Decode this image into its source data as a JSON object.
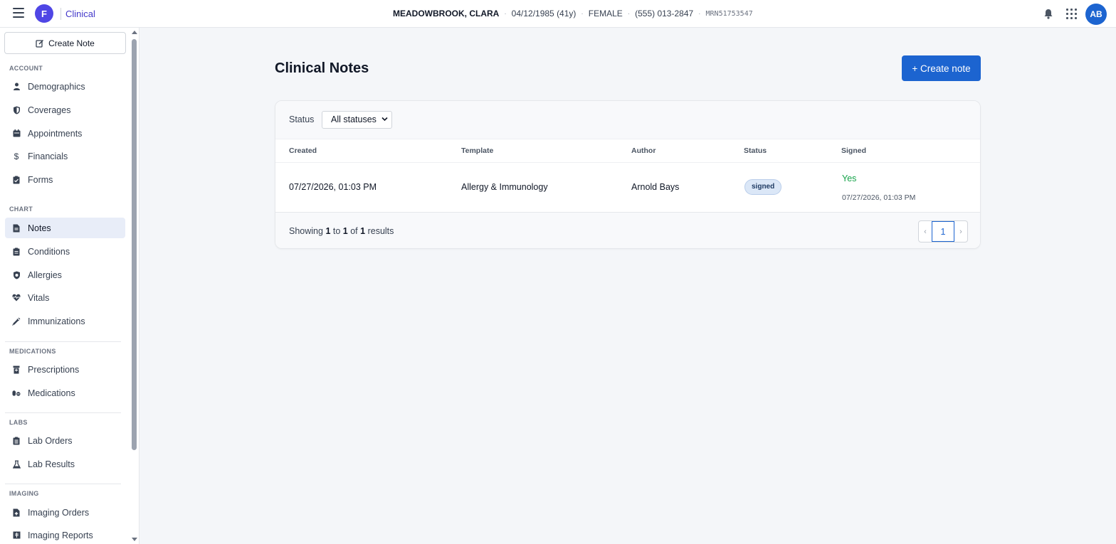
{
  "app": {
    "logo_letter": "F",
    "brand": "Clinical"
  },
  "patient": {
    "name": "MEADOWBROOK, CLARA",
    "dob": "04/12/1985 (41y)",
    "sex": "FEMALE",
    "phone": "(555) 013-2847",
    "mrn": "MRN51753547",
    "separator": "·"
  },
  "user": {
    "initials": "AB"
  },
  "sidebar": {
    "create_note_label": "Create Note",
    "sections": {
      "account": "ACCOUNT",
      "chart": "CHART",
      "medications": "MEDICATIONS",
      "labs": "LABS",
      "imaging": "IMAGING"
    },
    "items": {
      "demographics": "Demographics",
      "coverages": "Coverages",
      "appointments": "Appointments",
      "financials": "Financials",
      "forms": "Forms",
      "notes": "Notes",
      "conditions": "Conditions",
      "allergies": "Allergies",
      "vitals": "Vitals",
      "immunizations": "Immunizations",
      "prescriptions": "Prescriptions",
      "medications": "Medications",
      "lab_orders": "Lab Orders",
      "lab_results": "Lab Results",
      "imaging_orders": "Imaging Orders",
      "imaging_reports": "Imaging Reports"
    },
    "active_item": "notes"
  },
  "main": {
    "title": "Clinical Notes",
    "create_button": "+ Create note",
    "filter": {
      "label": "Status",
      "selected": "All statuses"
    },
    "table": {
      "columns": {
        "created": "Created",
        "template": "Template",
        "author": "Author",
        "status": "Status",
        "signed": "Signed"
      },
      "rows": [
        {
          "created": "07/27/2026, 01:03 PM",
          "template": "Allergy & Immunology",
          "author": "Arnold Bays",
          "status": "signed",
          "signed": "Yes",
          "signed_at": "07/27/2026, 01:03 PM"
        }
      ]
    },
    "footer": {
      "showing_prefix": "Showing",
      "from": "1",
      "to_word": "to",
      "to": "1",
      "of_word": "of",
      "total": "1",
      "results_word": "results",
      "prev": "‹",
      "page": "1",
      "next": "›"
    }
  },
  "colors": {
    "primary": "#1c64d0",
    "brand_purple": "#4f46e5",
    "signed_green": "#16a34a",
    "active_nav": "#e8edf8"
  }
}
